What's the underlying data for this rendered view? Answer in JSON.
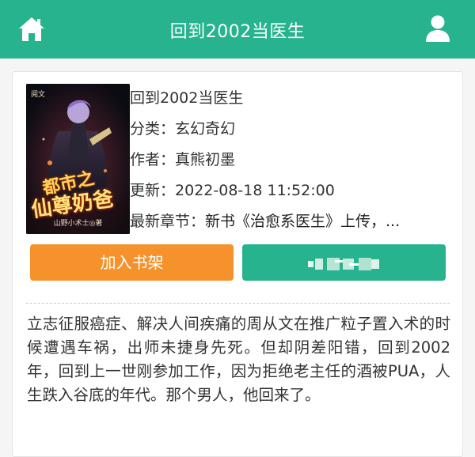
{
  "header": {
    "title": "回到2002当医生",
    "home_icon": "home-icon",
    "user_icon": "user-icon"
  },
  "book": {
    "title": "回到2002当医生",
    "category_label": "分类：",
    "category": "玄幻奇幻",
    "author_label": "作者：",
    "author": "真熊初墨",
    "updated_label": "更新：",
    "updated": "2022-08-18 11:52:00",
    "latest_label": "最新章节：",
    "latest_chapter": "新书《治愈系医生》上传，...",
    "cover": {
      "publisher": "阅文",
      "title_line1": "都市之",
      "title_line2": "仙尊奶爸",
      "author": "山野小术士◎著"
    }
  },
  "actions": {
    "add_to_shelf": "加入书架",
    "read_label": ""
  },
  "description": "立志征服癌症、解决人间疾痛的周从文在推广粒子置入术的时候遭遇车祸，出师未捷身先死。但却阴差阳错，回到2002年，回到上一世刚参加工作，因为拒绝老主任的酒被PUA，人生跌入谷底的年代。那个男人，他回来了。",
  "colors": {
    "header_bg": "#26b38e",
    "shelf_button": "#f5922b",
    "read_button": "#26b38e"
  }
}
